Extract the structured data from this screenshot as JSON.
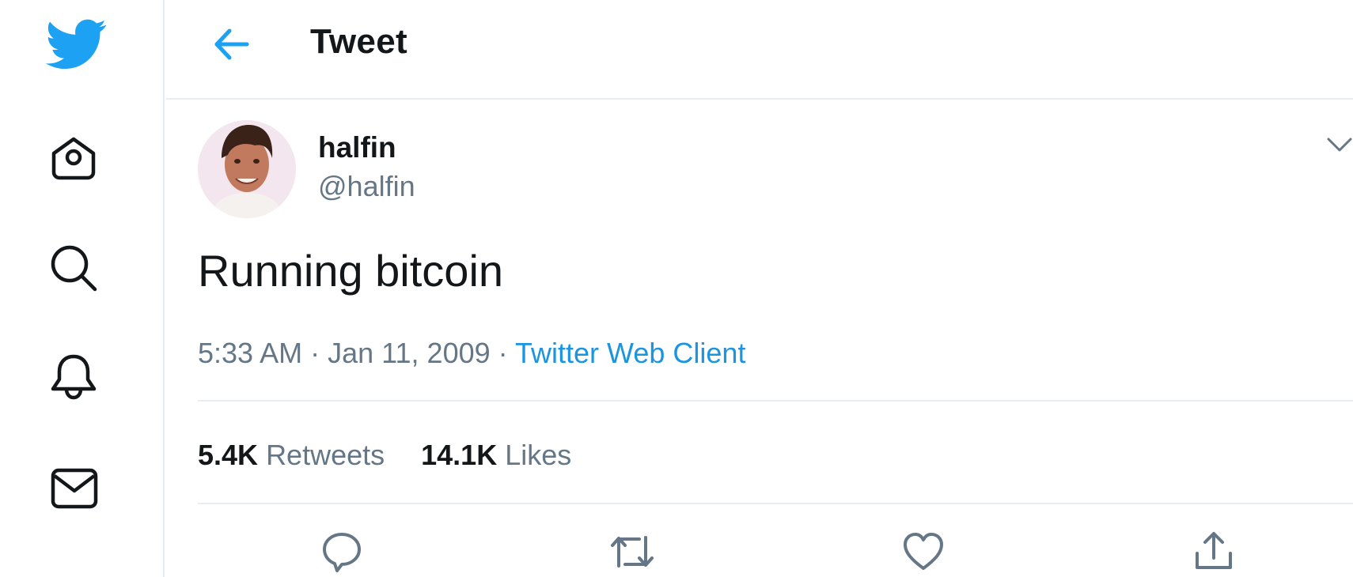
{
  "sidebar": {
    "icons": [
      "twitter-logo",
      "home-icon",
      "search-icon",
      "notifications-icon",
      "messages-icon"
    ]
  },
  "header": {
    "title": "Tweet"
  },
  "tweet": {
    "display_name": "halfin",
    "handle": "@halfin",
    "text": "Running bitcoin",
    "time": "5:33 AM",
    "date": "Jan 11, 2009",
    "separator": "·",
    "source": "Twitter Web Client"
  },
  "stats": {
    "retweets_count": "5.4K",
    "retweets_label": "Retweets",
    "likes_count": "14.1K",
    "likes_label": "Likes"
  },
  "actions": [
    "reply-icon",
    "retweet-icon",
    "like-icon",
    "share-icon"
  ],
  "colors": {
    "accent": "#1da1f2",
    "link": "#1b95e0",
    "secondary": "#657786",
    "border": "#e6ecf0"
  }
}
